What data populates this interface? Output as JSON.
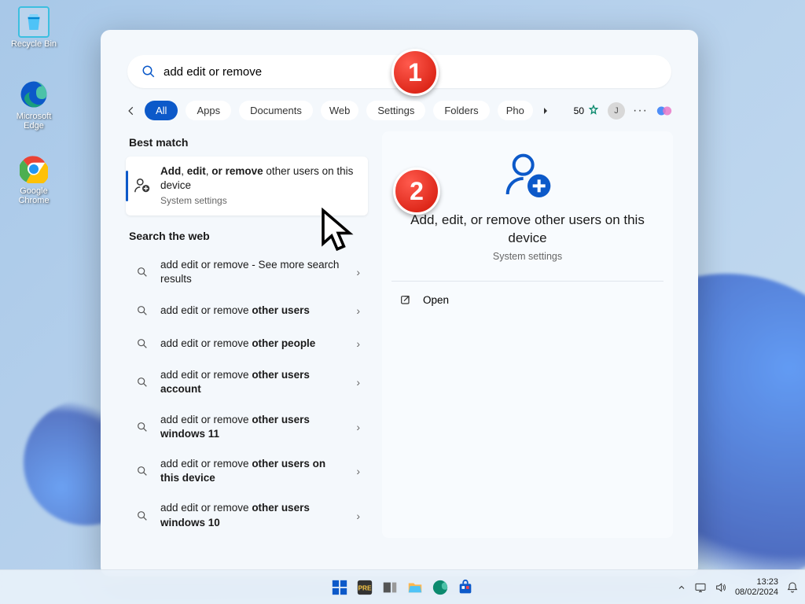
{
  "desktop": {
    "recycle": "Recycle Bin",
    "edge": "Microsoft Edge",
    "chrome": "Google Chrome"
  },
  "search": {
    "query": "add edit or remove"
  },
  "filters": {
    "all": "All",
    "apps": "Apps",
    "documents": "Documents",
    "web": "Web",
    "settings": "Settings",
    "folders": "Folders",
    "photos": "Pho"
  },
  "points": "50",
  "avatar": "J",
  "sections": {
    "best": "Best match",
    "web": "Search the web"
  },
  "best_match": {
    "title_html": "<b>Add</b>, <b>edit</b>, <b>or</b> <b>remove</b> other users on this device",
    "sub": "System settings"
  },
  "web_results": [
    {
      "prefix": "add edit or remove",
      "suffix": " - See more search results"
    },
    {
      "prefix": "add edit or remove ",
      "bold": "other users"
    },
    {
      "prefix": "add edit or remove ",
      "bold": "other people"
    },
    {
      "prefix": "add edit or remove ",
      "bold": "other users account"
    },
    {
      "prefix": "add edit or remove ",
      "bold": "other users windows 11"
    },
    {
      "prefix": "add edit or remove ",
      "bold": "other users on this device"
    },
    {
      "prefix": "add edit or remove ",
      "bold": "other users windows 10"
    }
  ],
  "preview": {
    "title": "Add, edit, or remove other users on this device",
    "sub": "System settings",
    "open": "Open"
  },
  "callouts": {
    "one": "1",
    "two": "2"
  },
  "taskbar": {
    "time": "13:23",
    "date": "08/02/2024"
  }
}
